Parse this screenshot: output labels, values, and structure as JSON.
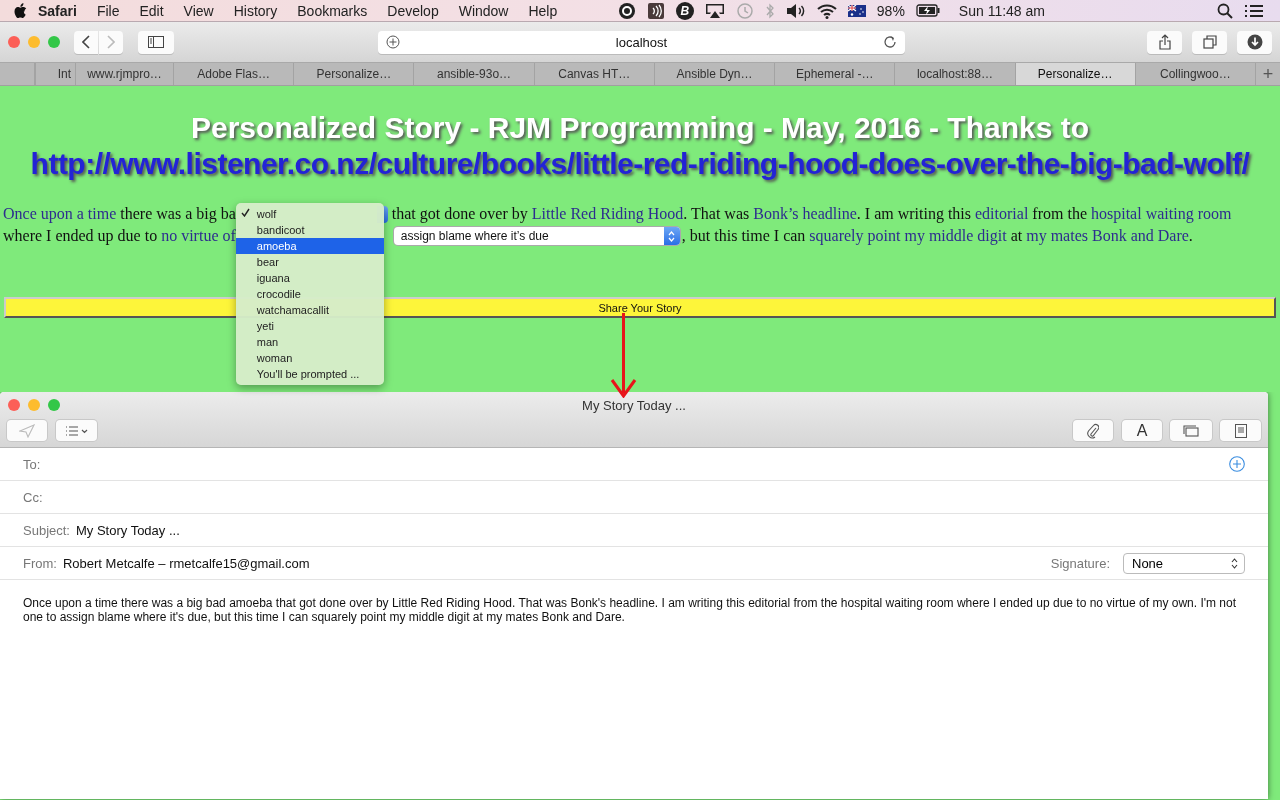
{
  "menu_bar": {
    "app": "Safari",
    "items": [
      "File",
      "Edit",
      "View",
      "History",
      "Bookmarks",
      "Develop",
      "Window",
      "Help"
    ],
    "status_letter": "B",
    "battery": "98%",
    "clock": "Sun 11:48 am"
  },
  "browser": {
    "address": "localhost",
    "tabs": [
      {
        "label": "Int",
        "selected": false
      },
      {
        "label": "www.rjmpro…",
        "selected": false
      },
      {
        "label": "Adobe Flas…",
        "selected": false
      },
      {
        "label": "Personalize…",
        "selected": false
      },
      {
        "label": "ansible-93o…",
        "selected": false
      },
      {
        "label": "Canvas HT…",
        "selected": false
      },
      {
        "label": "Ansible Dyn…",
        "selected": false
      },
      {
        "label": "Ephemeral -…",
        "selected": false
      },
      {
        "label": "localhost:88…",
        "selected": false
      },
      {
        "label": "Personalize…",
        "selected": true
      },
      {
        "label": "Collingwoo…",
        "selected": false
      }
    ],
    "new_tab": "+"
  },
  "page": {
    "heading": "Personalized Story - RJM Programming - May, 2016 - Thanks to",
    "heading_link": "http://www.listener.co.nz/culture/books/little-red-riding-hood-does-over-the-big-bad-wolf/",
    "story_lines": [
      [
        {
          "kind": "link",
          "text": "Once upon a time"
        },
        {
          "kind": "text",
          "text": " there was a big ba"
        },
        {
          "kind": "select",
          "open": true,
          "options": [
            {
              "label": "wolf",
              "checked": true,
              "selected": false
            },
            {
              "label": "bandicoot",
              "checked": false,
              "selected": false
            },
            {
              "label": "amoeba",
              "checked": false,
              "selected": true
            },
            {
              "label": "bear",
              "checked": false,
              "selected": false
            },
            {
              "label": "iguana",
              "checked": false,
              "selected": false
            },
            {
              "label": "crocodile",
              "checked": false,
              "selected": false
            },
            {
              "label": "watchamacallit",
              "checked": false,
              "selected": false
            },
            {
              "label": "yeti",
              "checked": false,
              "selected": false
            },
            {
              "label": "man",
              "checked": false,
              "selected": false
            },
            {
              "label": "woman",
              "checked": false,
              "selected": false
            },
            {
              "label": "You'll be prompted ...",
              "checked": false,
              "selected": false
            }
          ]
        },
        {
          "kind": "text",
          "text": " that got done over by "
        },
        {
          "kind": "link",
          "text": "Little Red Riding Hood"
        },
        {
          "kind": "text",
          "text": ". That was "
        },
        {
          "kind": "link",
          "text": "Bonk’s headline"
        },
        {
          "kind": "text",
          "text": ". I am writing this "
        },
        {
          "kind": "link",
          "text": "editorial"
        },
        {
          "kind": "text",
          "text": " from the "
        },
        {
          "kind": "link",
          "text": "hospital waiting room"
        }
      ],
      [
        {
          "kind": "text",
          "text": "where I ended up due to "
        },
        {
          "kind": "link",
          "text": "no virtue of"
        },
        {
          "kind": "select",
          "open": false,
          "value": "assign blame where it’s due"
        },
        {
          "kind": "text",
          "text": ", but this time I can "
        },
        {
          "kind": "link",
          "text": "squarely point my middle digit"
        },
        {
          "kind": "text",
          "text": " at "
        },
        {
          "kind": "link",
          "text": "my mates Bonk and Dare"
        },
        {
          "kind": "text",
          "text": "."
        }
      ]
    ],
    "share_button": "Share Your Story"
  },
  "mail": {
    "title": "My Story Today ...",
    "format_button": "A",
    "fields": [
      {
        "kind": "to",
        "label": "To:"
      },
      {
        "kind": "plain",
        "label": "Cc:"
      },
      {
        "kind": "plain",
        "label": "Subject:",
        "value": "My Story Today ..."
      },
      {
        "kind": "from",
        "label": "From:",
        "value": "Robert Metcalfe – rmetcalfe15@gmail.com",
        "signature_label": "Signature:",
        "signature": "None"
      }
    ],
    "body": "Once upon a time there was a big bad amoeba that got done over by Little Red Riding Hood. That was Bonk's headline. I am writing this editorial from the hospital waiting room where I ended up due to no virtue of my own. I'm not one to assign blame where it's due, but this time I can squarely point my middle digit at my mates Bonk and Dare."
  }
}
